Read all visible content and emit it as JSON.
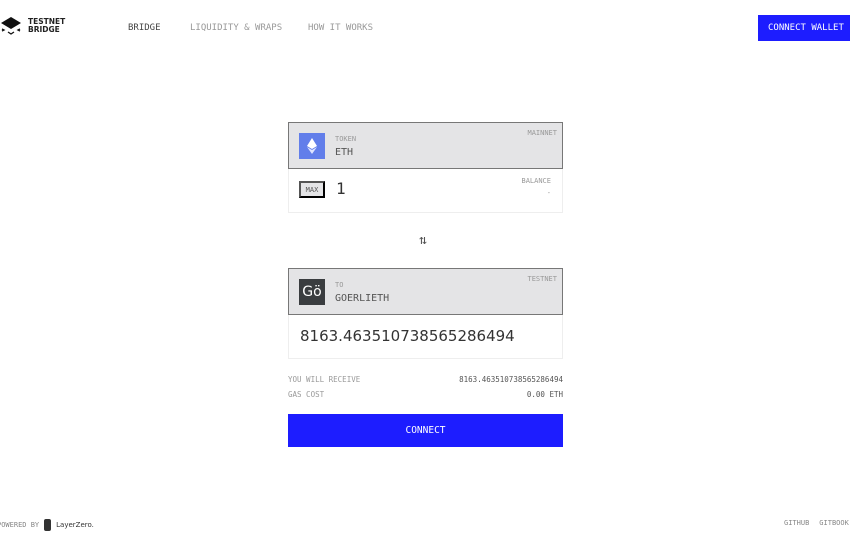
{
  "header": {
    "logo_line1": "TESTNET",
    "logo_line2": "BRIDGE",
    "nav": [
      "BRIDGE",
      "LIQUIDITY & WRAPS",
      "HOW IT WORKS"
    ],
    "connect_wallet": "CONNECT WALLET"
  },
  "from": {
    "label": "TOKEN",
    "token": "ETH",
    "network": "MAINNET",
    "max": "MAX",
    "amount": "1",
    "balance_label": "BALANCE",
    "balance": "-",
    "icon": "ethereum-icon",
    "icon_color": "#627eea"
  },
  "swap_icon": "swap-arrows-icon",
  "to": {
    "label": "TO",
    "token": "GOERLIETH",
    "network": "TESTNET",
    "icon_text": "Gö",
    "amount": "8163.463510738565286494"
  },
  "summary": {
    "receive_label": "YOU WILL RECEIVE",
    "receive_value": "8163.463510738565286494",
    "gas_label": "GAS COST",
    "gas_value": "0.00 ETH"
  },
  "connect_label": "CONNECT",
  "footer": {
    "powered_by": "POWERED BY",
    "brand": "LayerZero.",
    "links": [
      "GITHUB",
      "GITBOOK"
    ]
  },
  "colors": {
    "accent": "#1d1dff"
  }
}
